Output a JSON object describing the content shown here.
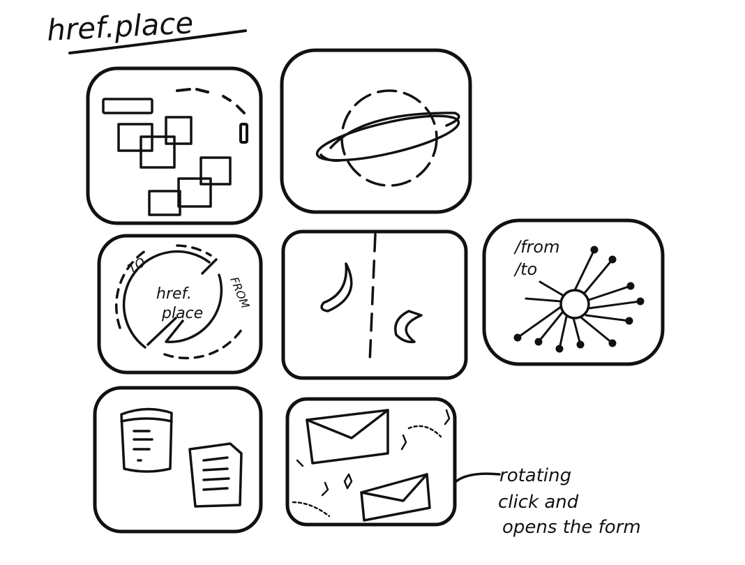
{
  "title": "href.place",
  "tiles": {
    "portal_label": "href.\nplace",
    "portal_to": "TO",
    "portal_from": "FROM",
    "radial_text": "/from\n/to"
  },
  "note": {
    "lines": [
      "rotating",
      "click and",
      "opens the form"
    ]
  },
  "colors": {
    "ink": "#111111",
    "paper": "#ffffff"
  }
}
